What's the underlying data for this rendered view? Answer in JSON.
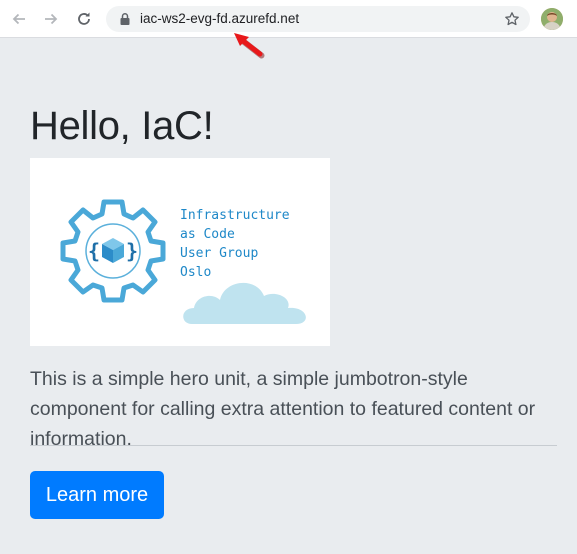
{
  "browser": {
    "url": "iac-ws2-evg-fd.azurefd.net",
    "icons": {
      "back": "arrow-left-icon",
      "forward": "arrow-right-icon",
      "reload": "reload-icon",
      "lock": "lock-icon",
      "bookmark": "star-icon",
      "profile": "avatar"
    }
  },
  "hero": {
    "title": "Hello, IaC!",
    "logo_lines": [
      "Infrastructure",
      "as Code",
      "User Group",
      "Oslo"
    ],
    "lead": "This is a simple hero unit, a simple jumbotron-style component for calling extra attention to featured content or information.",
    "button_label": "Learn more"
  },
  "colors": {
    "page_background": "#e9ecef",
    "primary": "#007bff",
    "logo_blue": "#1e88c8",
    "cloud": "#bfe3ef",
    "annotation_arrow": "#e8191b"
  }
}
